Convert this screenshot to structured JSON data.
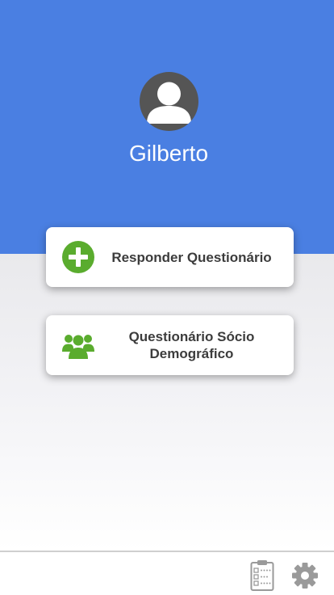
{
  "user": {
    "name": "Gilberto"
  },
  "actions": [
    {
      "label": "Responder Questionário",
      "icon": "plus-circle-icon"
    },
    {
      "label": "Questionário Sócio Demográfico",
      "icon": "users-group-icon"
    }
  ],
  "tabbar": {
    "items": [
      {
        "icon": "clipboard-checklist-icon"
      },
      {
        "icon": "gear-icon"
      }
    ]
  },
  "colors": {
    "header": "#4a7fe2",
    "icon_green": "#5aac2e",
    "avatar_bg": "#555555",
    "tab_icon": "#9a9a9a"
  }
}
